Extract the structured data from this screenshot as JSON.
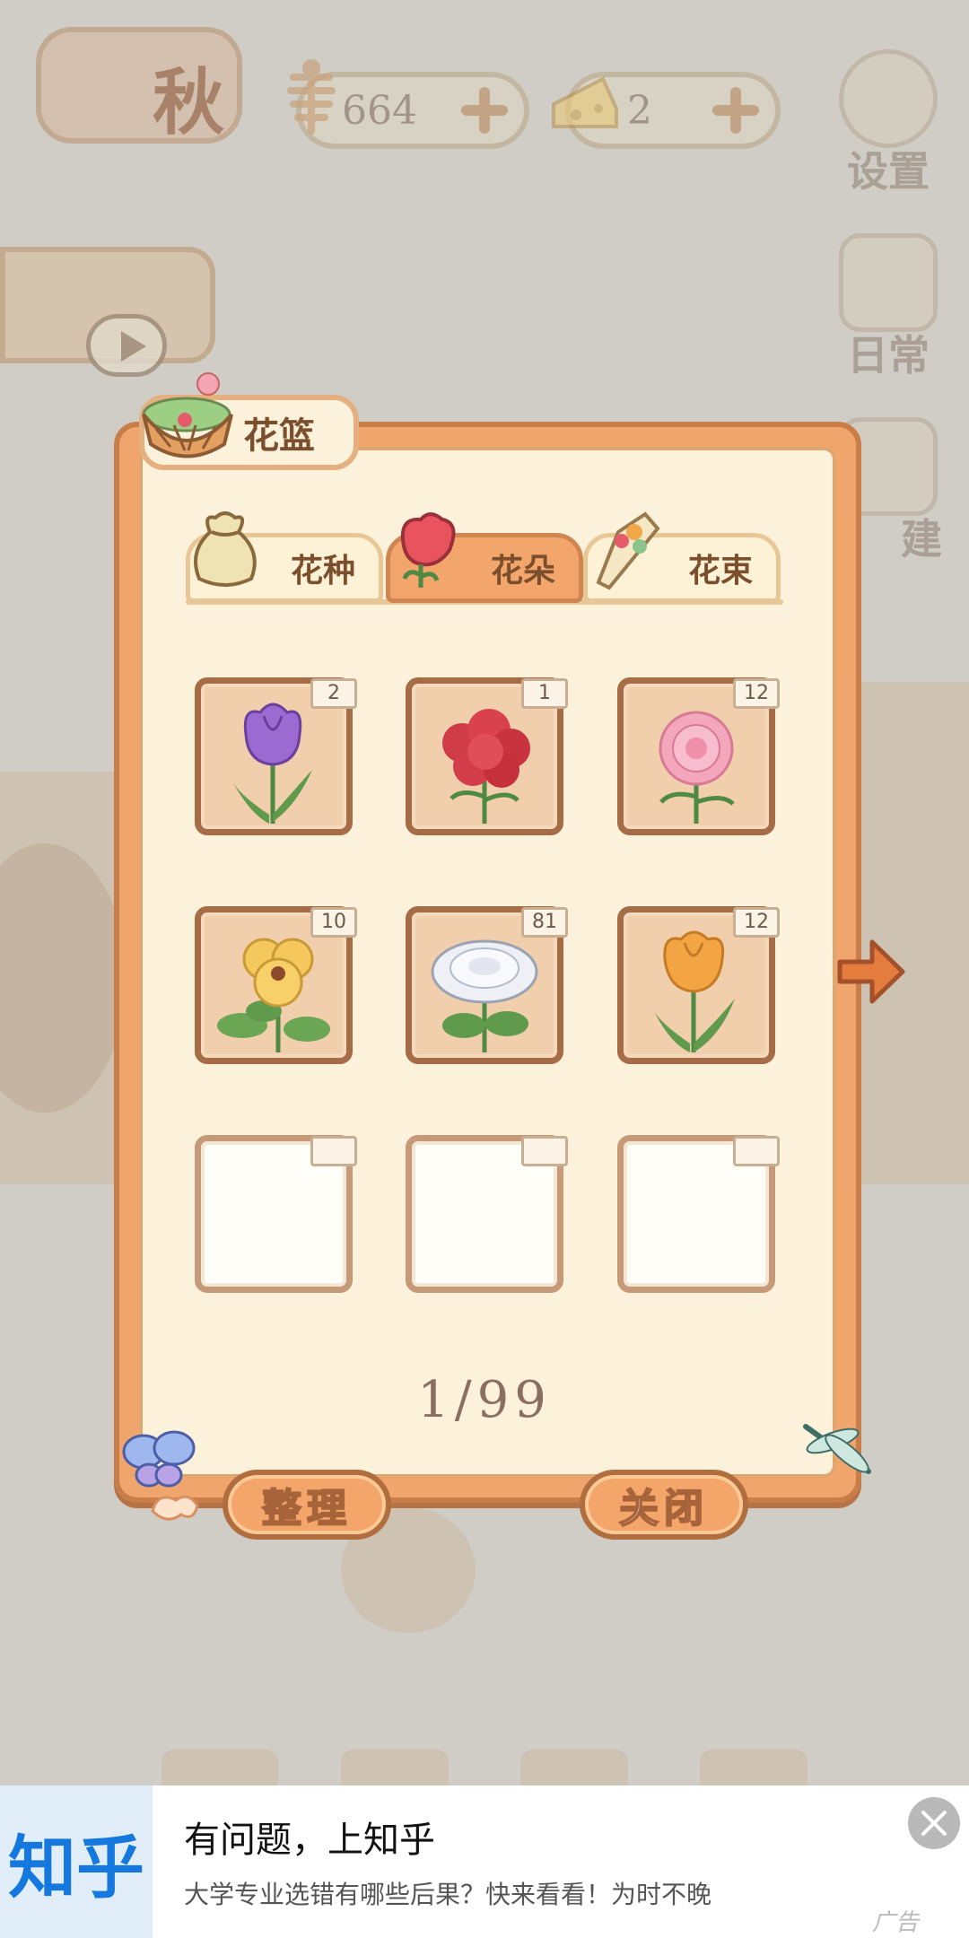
{
  "hud": {
    "season_label": "秋",
    "fish_count": "664",
    "cheese_count": "2",
    "settings_label": "设置",
    "daily_label": "日常",
    "build_label": "建"
  },
  "basket": {
    "title": "花篮",
    "tabs": [
      {
        "label": "花种",
        "icon": "seed-bag-icon",
        "active": false
      },
      {
        "label": "花朵",
        "icon": "rose-icon",
        "active": true
      },
      {
        "label": "花束",
        "icon": "bouquet-icon",
        "active": false
      }
    ],
    "slots": [
      {
        "flower": "purple-tulip",
        "count": "2",
        "color": "#8f5fc9"
      },
      {
        "flower": "red-hydrangea",
        "count": "1",
        "color": "#c62f3c"
      },
      {
        "flower": "pink-carnation",
        "count": "12",
        "color": "#ee8faa"
      },
      {
        "flower": "yellow-pansy",
        "count": "10",
        "color": "#f0c055"
      },
      {
        "flower": "white-chrysanthemum",
        "count": "81",
        "color": "#eef0f4"
      },
      {
        "flower": "orange-tulip",
        "count": "12",
        "color": "#f3a544"
      },
      {
        "flower": "",
        "count": ""
      },
      {
        "flower": "",
        "count": ""
      },
      {
        "flower": "",
        "count": ""
      }
    ],
    "page": "1/99",
    "sort_label": "整理",
    "close_label": "关闭"
  },
  "ad": {
    "logo": "知乎",
    "title": "有问题，上知乎",
    "subtitle": "大学专业选错有哪些后果？快来看看！为时不晚",
    "tag": "广告"
  }
}
